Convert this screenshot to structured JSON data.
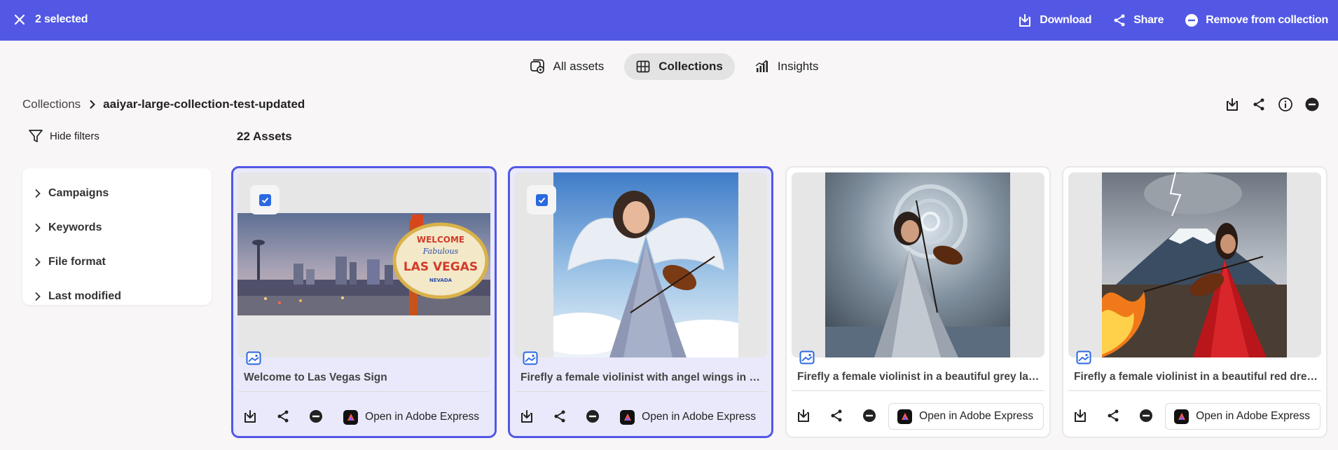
{
  "selection_bar": {
    "count_label": "2 selected",
    "download_label": "Download",
    "share_label": "Share",
    "remove_label": "Remove from collection",
    "color": "#5258e4"
  },
  "tabs": [
    {
      "label": "All assets",
      "icon": "all-assets-icon",
      "active": false
    },
    {
      "label": "Collections",
      "icon": "grid-icon",
      "active": true
    },
    {
      "label": "Insights",
      "icon": "insights-icon",
      "active": false
    }
  ],
  "breadcrumb": {
    "root": "Collections",
    "current": "aaiyar-large-collection-test-updated"
  },
  "filters": {
    "toggle_label": "Hide filters",
    "items": [
      "Campaigns",
      "Keywords",
      "File format",
      "Last modified"
    ]
  },
  "assets": {
    "count_label": "22 Assets",
    "open_label": "Open in Adobe Express",
    "cards": [
      {
        "title": "Welcome to Las Vegas Sign",
        "selected": true
      },
      {
        "title": "Firefly a female violinist with angel wings in a beautiful silver gown",
        "selected": true
      },
      {
        "title": "Firefly a female violinist in a beautiful grey lace dress in a storm",
        "selected": false
      },
      {
        "title": "Firefly a female violinist in a beautiful red dress playing by a volcano",
        "selected": false
      }
    ]
  },
  "sign": {
    "line1": "WELCOME",
    "line2": "Fabulous",
    "line3": "LAS VEGAS",
    "line4": "NEVADA"
  }
}
